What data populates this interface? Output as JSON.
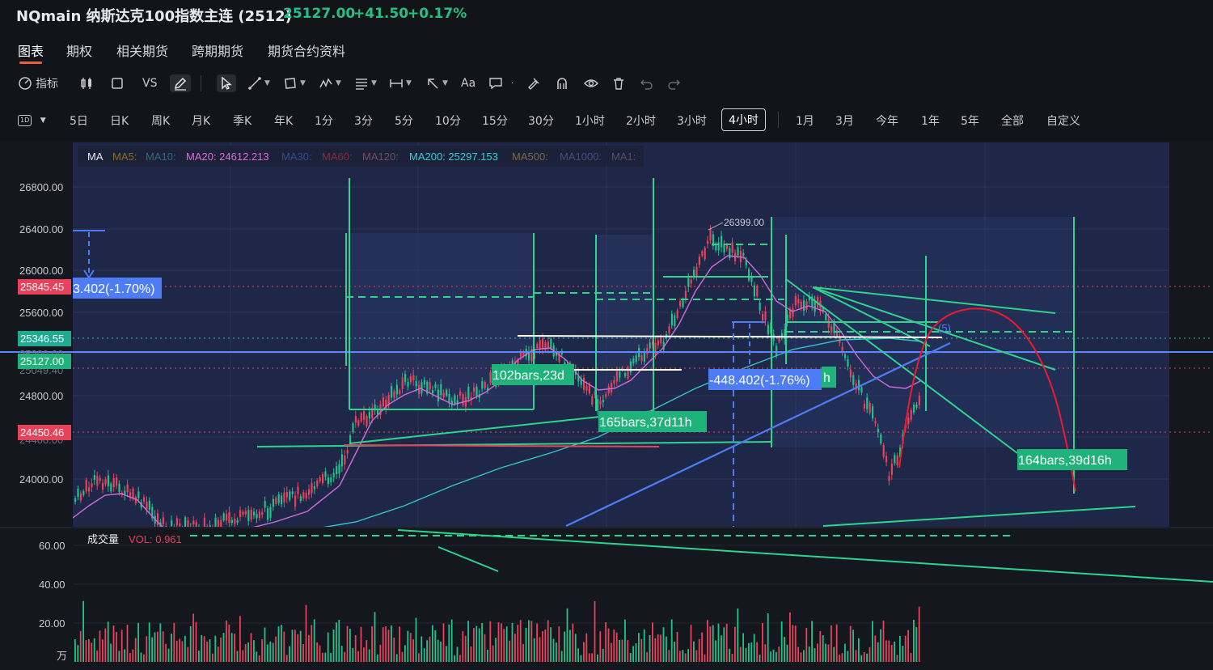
{
  "header": {
    "title": "NQmain 纳斯达克100指数主连 (2512)",
    "price": "25127.00",
    "change": "+41.50",
    "change_pct": "+0.17%"
  },
  "tabs": [
    "图表",
    "期权",
    "相关期货",
    "跨期期货",
    "期货合约资料"
  ],
  "active_tab": "图表",
  "toolbar": {
    "indicators_label": "指标",
    "vs_label": "VS",
    "text_label": "Aa"
  },
  "periods": {
    "selector_label": "1D",
    "items": [
      "5日",
      "日K",
      "周K",
      "月K",
      "季K",
      "年K",
      "1分",
      "3分",
      "5分",
      "10分",
      "15分",
      "30分",
      "1小时",
      "2小时",
      "3小时",
      "4小时"
    ],
    "ranges": [
      "1月",
      "3月",
      "今年",
      "1年",
      "5年",
      "全部",
      "自定义"
    ],
    "active": "4小时"
  },
  "ma_legend": {
    "ma": "MA",
    "ma5": "MA5:",
    "ma10": "MA10:",
    "ma20": "MA20: 24612.213",
    "ma30": "MA30:",
    "ma60": "MA60:",
    "ma120": "MA120:",
    "ma200": "MA200: 25297.153",
    "ma500": "MA500:",
    "ma1000": "MA1000:",
    "ma_more": "MA1:"
  },
  "price_axis": {
    "ticks": [
      "26800.00",
      "26400.00",
      "26000.00",
      "25600.00",
      "24800.00",
      "24000.00"
    ],
    "badges": {
      "b1": "25845.45",
      "b2": "25346.55",
      "b3": "25127.00",
      "b4": "24450.46",
      "hidden1": "25200.00",
      "hidden2": "25049.40"
    }
  },
  "annotations": {
    "measure1": "3.402(-1.70%)",
    "measure2": "-448.402(-1.76%)",
    "bars1": "102bars,23d",
    "bars2": "165bars,37d11h",
    "bars3": "164bars,39d16h",
    "bars4": "h",
    "peak": "26399.00",
    "wave": "(5)"
  },
  "volume": {
    "title": "成交量",
    "vol_label": "VOL: 0.961",
    "ticks": [
      "60.00",
      "40.00",
      "20.00"
    ],
    "unit": "万"
  },
  "colors": {
    "up": "#22c18a",
    "down": "#e8415a",
    "accent": "#4d7cf5",
    "drawing_green": "#2dd48c",
    "bg": "#131419"
  }
}
